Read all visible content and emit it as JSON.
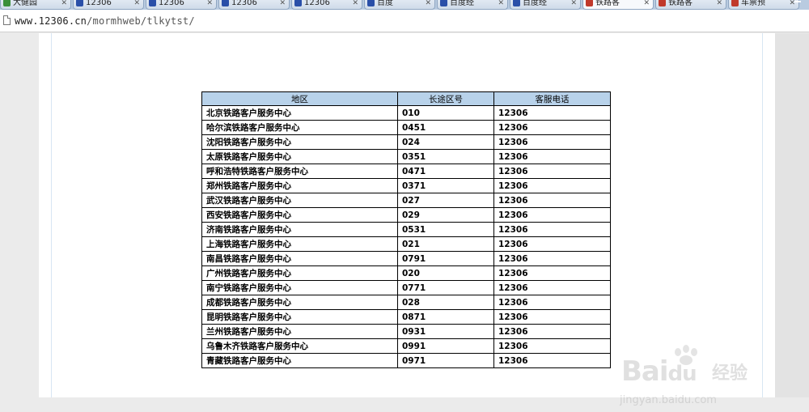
{
  "browser": {
    "tabs": [
      {
        "label": "大健园",
        "icon_color": "#3a8f3a"
      },
      {
        "label": "12306",
        "icon_color": "#2a4fa8"
      },
      {
        "label": "12306",
        "icon_color": "#2a4fa8"
      },
      {
        "label": "12306",
        "icon_color": "#2a4fa8"
      },
      {
        "label": "12306",
        "icon_color": "#2a4fa8"
      },
      {
        "label": "百度",
        "icon_color": "#2a4fa8"
      },
      {
        "label": "百度经",
        "icon_color": "#2a4fa8"
      },
      {
        "label": "百度经",
        "icon_color": "#2a4fa8"
      },
      {
        "label": "铁路客",
        "icon_color": "#c0392b"
      },
      {
        "label": "铁路客",
        "icon_color": "#c0392b"
      },
      {
        "label": "车票预",
        "icon_color": "#c0392b"
      }
    ],
    "tab_close_glyph": "✕",
    "url_host": "www.12306.cn",
    "url_path": "/mormhweb/tlkytst/"
  },
  "table": {
    "headers": [
      "地区",
      "长途区号",
      "客服电话"
    ],
    "rows": [
      [
        "北京铁路客户服务中心",
        "010",
        "12306"
      ],
      [
        "哈尔滨铁路客户服务中心",
        "0451",
        "12306"
      ],
      [
        "沈阳铁路客户服务中心",
        "024",
        "12306"
      ],
      [
        "太原铁路客户服务中心",
        "0351",
        "12306"
      ],
      [
        "呼和浩特铁路客户服务中心",
        "0471",
        "12306"
      ],
      [
        "郑州铁路客户服务中心",
        "0371",
        "12306"
      ],
      [
        "武汉铁路客户服务中心",
        "027",
        "12306"
      ],
      [
        "西安铁路客户服务中心",
        "029",
        "12306"
      ],
      [
        "济南铁路客户服务中心",
        "0531",
        "12306"
      ],
      [
        "上海铁路客户服务中心",
        "021",
        "12306"
      ],
      [
        "南昌铁路客户服务中心",
        "0791",
        "12306"
      ],
      [
        "广州铁路客户服务中心",
        "020",
        "12306"
      ],
      [
        "南宁铁路客户服务中心",
        "0771",
        "12306"
      ],
      [
        "成都铁路客户服务中心",
        "028",
        "12306"
      ],
      [
        "昆明铁路客户服务中心",
        "0871",
        "12306"
      ],
      [
        "兰州铁路客户服务中心",
        "0931",
        "12306"
      ],
      [
        "乌鲁木齐铁路客户服务中心",
        "0991",
        "12306"
      ],
      [
        "青藏铁路客户服务中心",
        "0971",
        "12306"
      ]
    ]
  },
  "watermark": {
    "brand": "Bai",
    "brand_tail": "du",
    "brand_cn": "经验",
    "sub": "jingyan.baidu.com"
  }
}
